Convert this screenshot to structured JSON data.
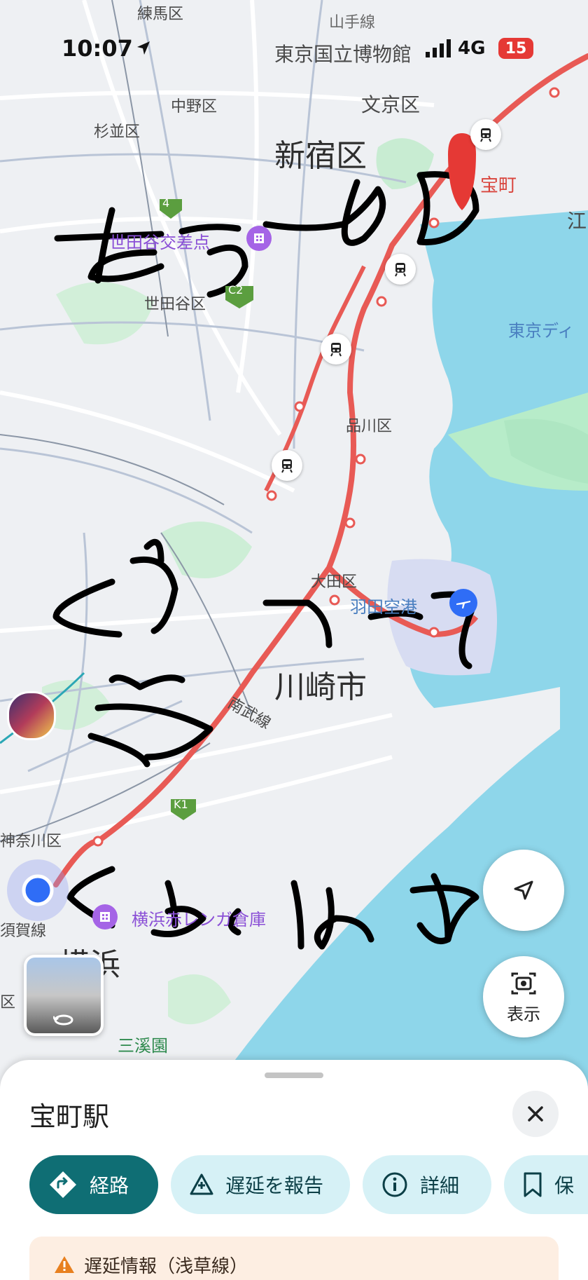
{
  "status_bar": {
    "time": "10:07",
    "network": "4G",
    "battery": "15"
  },
  "map": {
    "labels": {
      "nerima": "練馬区",
      "yamanote": "山手線",
      "museum": "東京国立博物館",
      "nakano": "中野区",
      "bunkyo": "文京区",
      "suginami": "杉並区",
      "shinjuku": "新宿区",
      "takaracho": "宝町",
      "setagaya_crossing": "世田谷交差点",
      "setagaya": "世田谷区",
      "tokyo_disney": "東京ディ",
      "shinagawa": "品川区",
      "ota": "大田区",
      "haneda": "羽田空港",
      "kawasaki": "川崎市",
      "nambu": "南武線",
      "kanagawa": "神奈川区",
      "yokohama_redbrick": "横浜赤レンガ倉庫",
      "yokohama": "横浜",
      "sankeien": "三溪園",
      "yokosuka": "須賀線",
      "ku": "区",
      "edge_e": "江",
      "route_4": "4",
      "route_c2": "C2",
      "route_k1": "K1"
    }
  },
  "controls": {
    "show_label": "表示"
  },
  "sheet": {
    "title": "宝町駅",
    "chips": {
      "route": "経路",
      "report_delay": "遅延を報告",
      "details": "詳細",
      "save": "保"
    },
    "alert": "遅延情報（浅草線）"
  },
  "colors": {
    "route_line": "#e85a55",
    "primary_chip": "#0f6e74",
    "secondary_chip": "#d6f1f6",
    "water": "#8ed6ea"
  }
}
